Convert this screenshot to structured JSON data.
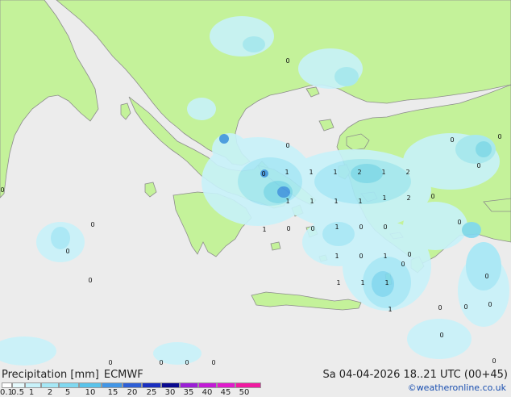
{
  "header": {
    "product": "Precipitation [mm]",
    "model": "ECMWF",
    "valid_time": "Sa 04-04-2026 18..21 UTC (00+45)"
  },
  "credit": "©weatheronline.co.uk",
  "colors": {
    "sea": "#ececec",
    "land": "#c4f29a",
    "border": "#8c8c8c"
  },
  "legend": {
    "ticks": [
      "0.1",
      "0.5",
      "1",
      "2",
      "5",
      "10",
      "15",
      "20",
      "25",
      "30",
      "35",
      "40",
      "45",
      "50"
    ],
    "colors": [
      "#ffffff",
      "#e6fafd",
      "#c8f2fa",
      "#a6e8f6",
      "#7fd8f0",
      "#59c3ea",
      "#4296e6",
      "#2e5fd6",
      "#1a2fbf",
      "#0a0a90",
      "#9b1fd6",
      "#c21bd6",
      "#e01bcc",
      "#f01aa0"
    ]
  },
  "map_values": {
    "numbers": [
      "0",
      "0",
      "0",
      "1",
      "1",
      "1",
      "2",
      "1",
      "2",
      "1",
      "1",
      "1",
      "1",
      "1",
      "2",
      "0",
      "0",
      "0",
      "0",
      "0",
      "0",
      "1",
      "0",
      "0",
      "1",
      "0",
      "0",
      "0",
      "1",
      "0",
      "1",
      "0",
      "1",
      "1",
      "1",
      "1",
      "0",
      "0",
      "0",
      "0",
      "0",
      "0",
      "0",
      "0",
      "0",
      "0",
      "0",
      "0",
      "0"
    ]
  }
}
